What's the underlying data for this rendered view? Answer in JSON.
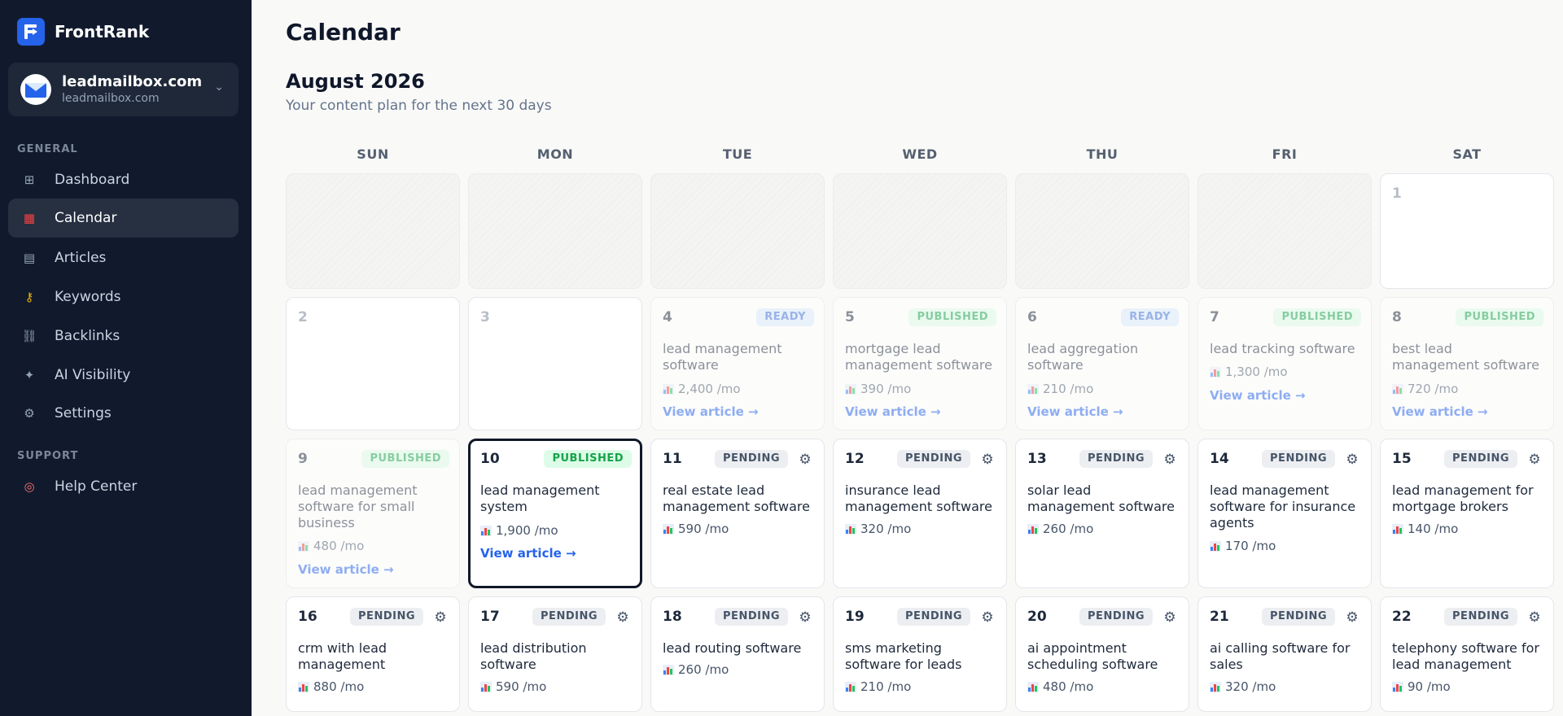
{
  "app": {
    "name": "FrontRank"
  },
  "site": {
    "title": "leadmailbox.com",
    "subtitle": "leadmailbox.com"
  },
  "sidebar": {
    "general_label": "GENERAL",
    "support_label": "SUPPORT",
    "items": [
      {
        "label": "Dashboard",
        "icon": "grid-icon"
      },
      {
        "label": "Calendar",
        "icon": "calendar-icon"
      },
      {
        "label": "Articles",
        "icon": "document-icon"
      },
      {
        "label": "Keywords",
        "icon": "key-icon"
      },
      {
        "label": "Backlinks",
        "icon": "link-icon"
      },
      {
        "label": "AI Visibility",
        "icon": "sparkle-icon"
      },
      {
        "label": "Settings",
        "icon": "gear-icon"
      }
    ],
    "support_items": [
      {
        "label": "Help Center",
        "icon": "lifebuoy-icon"
      }
    ]
  },
  "page": {
    "title": "Calendar",
    "month": "August 2026",
    "subtitle": "Your content plan for the next 30 days"
  },
  "weekdays": [
    "SUN",
    "MON",
    "TUE",
    "WED",
    "THU",
    "FRI",
    "SAT"
  ],
  "view_article_label": "View article →",
  "volume_suffix": "/mo",
  "days": {
    "d1": {
      "num": "1"
    },
    "d2": {
      "num": "2"
    },
    "d3": {
      "num": "3"
    },
    "d4": {
      "num": "4",
      "status": "READY",
      "keyword": "lead management software",
      "volume": "2,400"
    },
    "d5": {
      "num": "5",
      "status": "PUBLISHED",
      "keyword": "mortgage lead management software",
      "volume": "390"
    },
    "d6": {
      "num": "6",
      "status": "READY",
      "keyword": "lead aggregation software",
      "volume": "210"
    },
    "d7": {
      "num": "7",
      "status": "PUBLISHED",
      "keyword": "lead tracking software",
      "volume": "1,300"
    },
    "d8": {
      "num": "8",
      "status": "PUBLISHED",
      "keyword": "best lead management software",
      "volume": "720"
    },
    "d9": {
      "num": "9",
      "status": "PUBLISHED",
      "keyword": "lead management software for small business",
      "volume": "480"
    },
    "d10": {
      "num": "10",
      "status": "PUBLISHED",
      "keyword": "lead management system",
      "volume": "1,900"
    },
    "d11": {
      "num": "11",
      "status": "PENDING",
      "keyword": "real estate lead management software",
      "volume": "590"
    },
    "d12": {
      "num": "12",
      "status": "PENDING",
      "keyword": "insurance lead management software",
      "volume": "320"
    },
    "d13": {
      "num": "13",
      "status": "PENDING",
      "keyword": "solar lead management software",
      "volume": "260"
    },
    "d14": {
      "num": "14",
      "status": "PENDING",
      "keyword": "lead management software for insurance agents",
      "volume": "170"
    },
    "d15": {
      "num": "15",
      "status": "PENDING",
      "keyword": "lead management for mortgage brokers",
      "volume": "140"
    },
    "d16": {
      "num": "16",
      "status": "PENDING",
      "keyword": "crm with lead management",
      "volume": "880"
    },
    "d17": {
      "num": "17",
      "status": "PENDING",
      "keyword": "lead distribution software",
      "volume": "590"
    },
    "d18": {
      "num": "18",
      "status": "PENDING",
      "keyword": "lead routing software",
      "volume": "260"
    },
    "d19": {
      "num": "19",
      "status": "PENDING",
      "keyword": "sms marketing software for leads",
      "volume": "210"
    },
    "d20": {
      "num": "20",
      "status": "PENDING",
      "keyword": "ai appointment scheduling software",
      "volume": "480"
    },
    "d21": {
      "num": "21",
      "status": "PENDING",
      "keyword": "ai calling software for sales",
      "volume": "320"
    },
    "d22": {
      "num": "22",
      "status": "PENDING",
      "keyword": "telephony software for lead management",
      "volume": "90"
    }
  }
}
